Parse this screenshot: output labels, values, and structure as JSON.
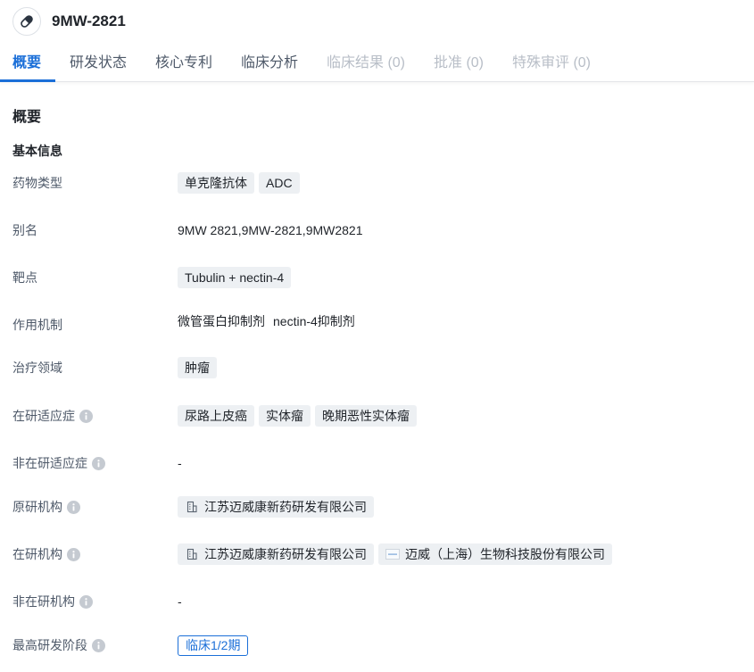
{
  "drug": {
    "title": "9MW-2821",
    "icon": "pill-icon"
  },
  "tabs": [
    {
      "label": "概要",
      "state": "active"
    },
    {
      "label": "研发状态",
      "state": "normal"
    },
    {
      "label": "核心专利",
      "state": "normal"
    },
    {
      "label": "临床分析",
      "state": "normal"
    },
    {
      "label": "临床结果 (0)",
      "state": "disabled"
    },
    {
      "label": "批准 (0)",
      "state": "disabled"
    },
    {
      "label": "特殊审评 (0)",
      "state": "disabled"
    }
  ],
  "overview": {
    "section_title": "概要",
    "subsection_title": "基本信息",
    "rows": {
      "drug_type": {
        "label": "药物类型",
        "tags": [
          "单克隆抗体",
          "ADC"
        ]
      },
      "alias": {
        "label": "别名",
        "text": "9MW 2821,9MW-2821,9MW2821"
      },
      "target": {
        "label": "靶点",
        "tags": [
          "Tubulin + nectin-4"
        ]
      },
      "mechanism": {
        "label": "作用机制",
        "items": [
          "微管蛋白抑制剂",
          "nectin-4抑制剂"
        ]
      },
      "therapeutic_area": {
        "label": "治疗领域",
        "tags": [
          "肿瘤"
        ]
      },
      "active_indications": {
        "label": "在研适应症",
        "tags": [
          "尿路上皮癌",
          "实体瘤",
          "晚期恶性实体瘤"
        ]
      },
      "inactive_indications": {
        "label": "非在研适应症",
        "text": "-"
      },
      "originator": {
        "label": "原研机构",
        "orgs": [
          "江苏迈威康新药研发有限公司"
        ]
      },
      "active_orgs": {
        "label": "在研机构",
        "orgs": [
          "江苏迈威康新药研发有限公司",
          "迈威（上海）生物科技股份有限公司"
        ]
      },
      "inactive_orgs": {
        "label": "非在研机构",
        "text": "-"
      },
      "highest_phase": {
        "label": "最高研发阶段",
        "tag": "临床1/2期"
      }
    }
  },
  "colors": {
    "accent": "#1b6fd8",
    "tag_bg": "#edf0f3",
    "disabled": "#b8bec7"
  }
}
